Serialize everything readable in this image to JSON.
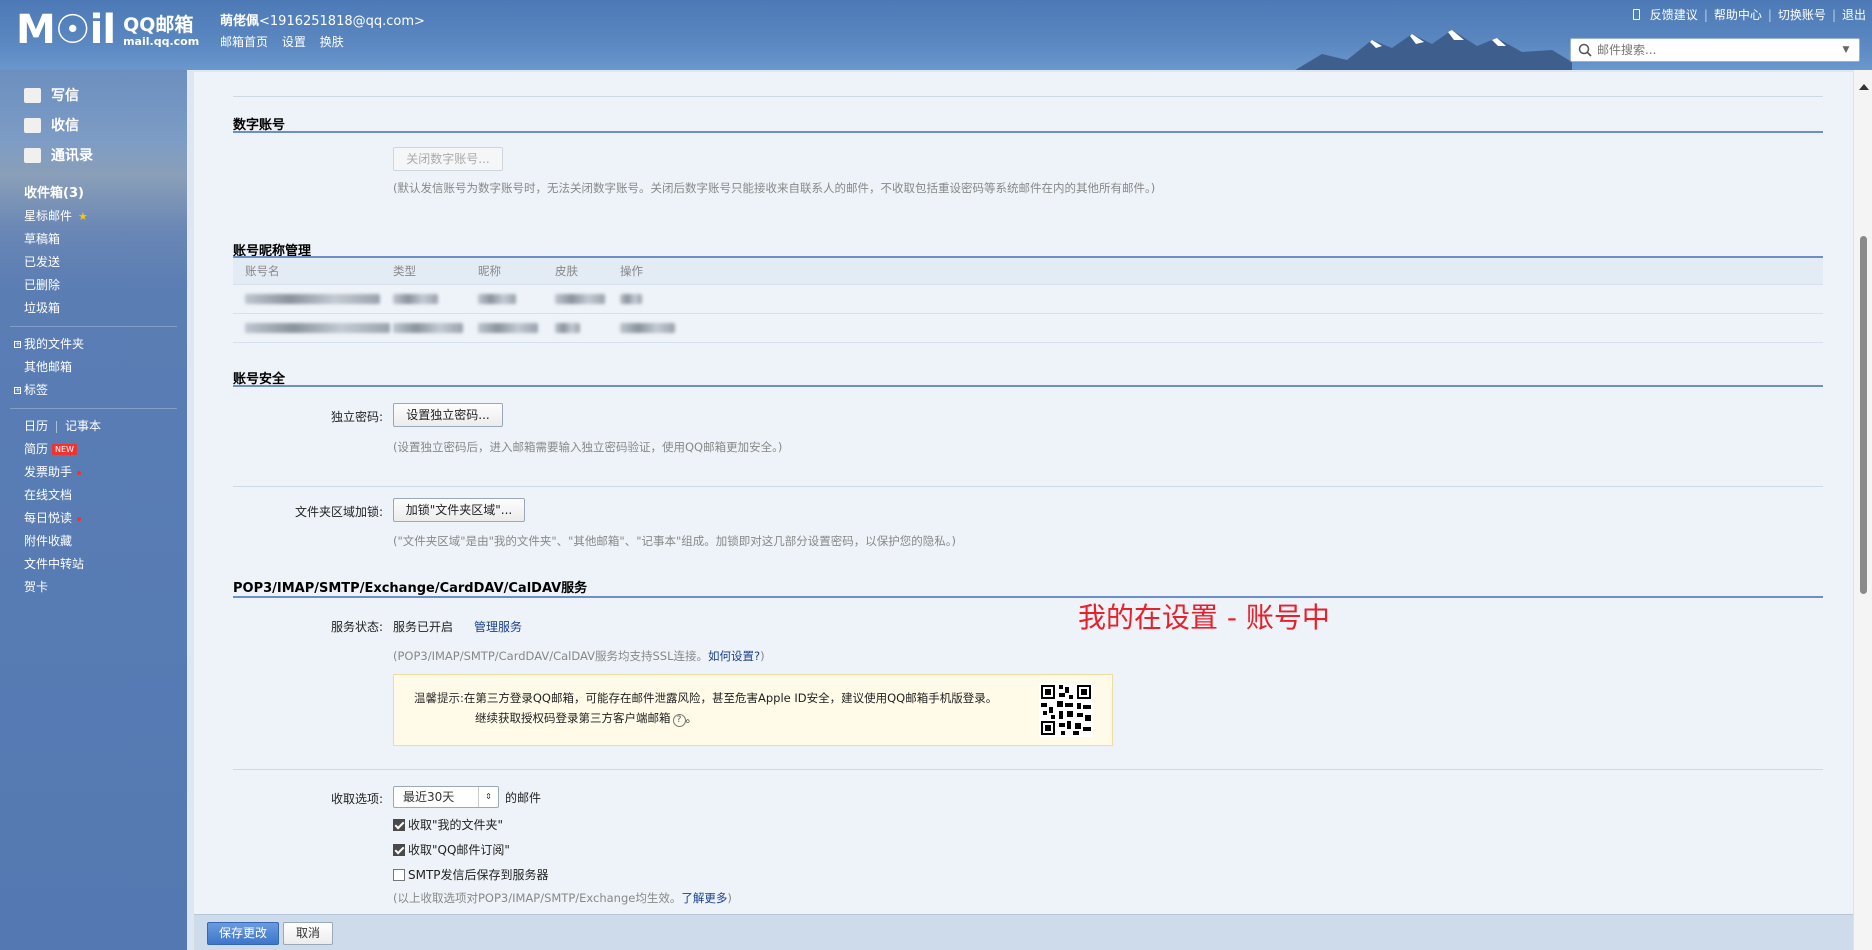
{
  "header": {
    "logo_text": "M☉il",
    "logo_brand": "QQ邮箱",
    "logo_url": "mail.qq.com",
    "user_name": "萌佬佩",
    "user_email": "<1916251818@qq.com>",
    "links": [
      "邮箱首页",
      "设置",
      "换肤"
    ],
    "top_links": [
      "反馈建议",
      "帮助中心",
      "切换账号",
      "退出"
    ],
    "search_placeholder": "邮件搜索..."
  },
  "sidebar": {
    "main": [
      "写信",
      "收信",
      "通讯录"
    ],
    "folders": [
      "收件箱(3)",
      "星标邮件",
      "草稿箱",
      "已发送",
      "已删除",
      "垃圾箱"
    ],
    "groups": [
      "我的文件夹",
      "其他邮箱",
      "标签"
    ],
    "calendar": "日历",
    "notes": "记事本",
    "apps": [
      "简历",
      "发票助手",
      "在线文档",
      "每日悦读",
      "附件收藏",
      "文件中转站",
      "贺卡"
    ],
    "new_badge": "NEW"
  },
  "digital": {
    "title": "数字账号",
    "button": "关闭数字账号...",
    "hint": "(默认发信账号为数字账号时，无法关闭数字账号。关闭后数字账号只能接收来自联系人的邮件，不收取包括重设密码等系统邮件在内的其他所有邮件。)"
  },
  "nickname": {
    "title": "账号昵称管理",
    "columns": [
      "账号名",
      "类型",
      "昵称",
      "皮肤",
      "操作"
    ]
  },
  "security": {
    "title": "账号安全",
    "pwd_label": "独立密码:",
    "pwd_button": "设置独立密码...",
    "pwd_hint": "(设置独立密码后，进入邮箱需要输入独立密码验证，使用QQ邮箱更加安全。)",
    "lock_label": "文件夹区域加锁:",
    "lock_button": "加锁\"文件夹区域\"...",
    "lock_hint": "(\"文件夹区域\"是由\"我的文件夹\"、\"其他邮箱\"、\"记事本\"组成。加锁即对这几部分设置密码，以保护您的隐私。)"
  },
  "annotation": "我的在设置 - 账号中",
  "pop": {
    "title": "POP3/IMAP/SMTP/Exchange/CardDAV/CalDAV服务",
    "status_label": "服务状态:",
    "status": "服务已开启",
    "manage": "管理服务",
    "ssl_hint": "(POP3/IMAP/SMTP/CardDAV/CalDAV服务均支持SSL连接。",
    "ssl_link": "如何设置?",
    "ssl_end": ")",
    "notice_prefix": "温馨提示:",
    "notice_line1": "在第三方登录QQ邮箱，可能存在邮件泄露风险，甚至危害Apple ID安全，建议使用QQ邮箱手机版登录。",
    "notice_line2": "继续获取授权码登录第三方客户端邮箱",
    "fetch_label": "收取选项:",
    "fetch_select": "最近30天",
    "fetch_suffix": "的邮件",
    "checks": [
      {
        "label": "收取\"我的文件夹\"",
        "checked": true
      },
      {
        "label": "收取\"QQ邮件订阅\"",
        "checked": true
      },
      {
        "label": "SMTP发信后保存到服务器",
        "checked": false
      }
    ],
    "options_hint": "(以上收取选项对POP3/IMAP/SMTP/Exchange均生效。",
    "options_link": "了解更多",
    "options_end": ")"
  },
  "footer": {
    "save": "保存更改",
    "cancel": "取消"
  }
}
